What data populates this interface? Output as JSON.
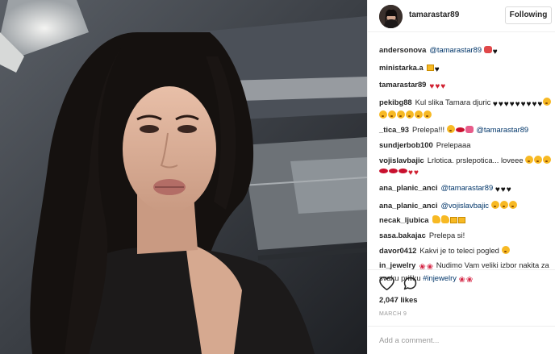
{
  "header": {
    "username": "tamarastar89",
    "follow_label": "Following"
  },
  "comments": [
    {
      "user": "andersonova",
      "mention": "@tamarastar89",
      "text": "",
      "emoji": [
        "devil-emoji",
        "black-heart"
      ]
    },
    {
      "user": "ministarka.a",
      "mention": "",
      "text": "",
      "emoji": [
        "box-emoji",
        "black-heart"
      ]
    },
    {
      "user": "tamarastar89",
      "mention": "",
      "text": "",
      "emoji": [
        "red-heart",
        "red-heart",
        "red-heart"
      ]
    },
    {
      "user": "pekibg88",
      "mention": "",
      "text": "Kul slika Tamara djuric",
      "emoji": [
        "black-heart",
        "black-heart",
        "black-heart",
        "black-heart",
        "black-heart",
        "black-heart",
        "black-heart",
        "black-heart",
        "black-heart",
        "face",
        "face",
        "face",
        "face",
        "face",
        "face",
        "face"
      ]
    },
    {
      "user": "_tica_93",
      "mention": "@tamarastar89",
      "text": "Prelepa!!!",
      "emoji": [
        "face",
        "lips",
        "cat-face"
      ]
    },
    {
      "user": "sundjerbob100",
      "mention": "",
      "text": "Prelepaaa",
      "emoji": []
    },
    {
      "user": "vojislavbajic",
      "mention": "",
      "text": "Lrlotica. prslepotica... loveee",
      "emoji": [
        "face",
        "face",
        "face",
        "lips",
        "lips",
        "lips",
        "red-heart",
        "red-heart"
      ]
    },
    {
      "user": "ana_planic_anci",
      "mention": "@tamarastar89",
      "text": "",
      "emoji": [
        "black-heart",
        "black-heart",
        "black-heart"
      ]
    },
    {
      "user": "ana_planic_anci",
      "mention": "@vojislavbajic",
      "text": "",
      "emoji": [
        "face",
        "face",
        "face"
      ]
    },
    {
      "user": "necak_ljubica",
      "mention": "",
      "text": "",
      "emoji": [
        "flex",
        "flex",
        "box-emoji",
        "box-emoji"
      ]
    },
    {
      "user": "sasa.bakajac",
      "mention": "",
      "text": "Prelepa si!",
      "emoji": []
    },
    {
      "user": "davor0412",
      "mention": "",
      "text": "Kakvi je to teleci pogled",
      "emoji": [
        "face"
      ]
    },
    {
      "user": "in_jewelry",
      "mention": "#injewelry",
      "text": "Nudimo Vam veliki izbor nakita za svaku priliku",
      "emoji": [
        "rose",
        "rose"
      ]
    }
  ],
  "actions": {
    "like_icon": "heart-outline-icon",
    "comment_icon": "comment-bubble-icon",
    "likes_count": "2,047 likes",
    "date": "MARCH 9"
  },
  "add_comment": {
    "placeholder": "Add a comment..."
  },
  "colors": {
    "mention": "#003569",
    "heart": "#d01f2f",
    "border": "#efefef"
  }
}
